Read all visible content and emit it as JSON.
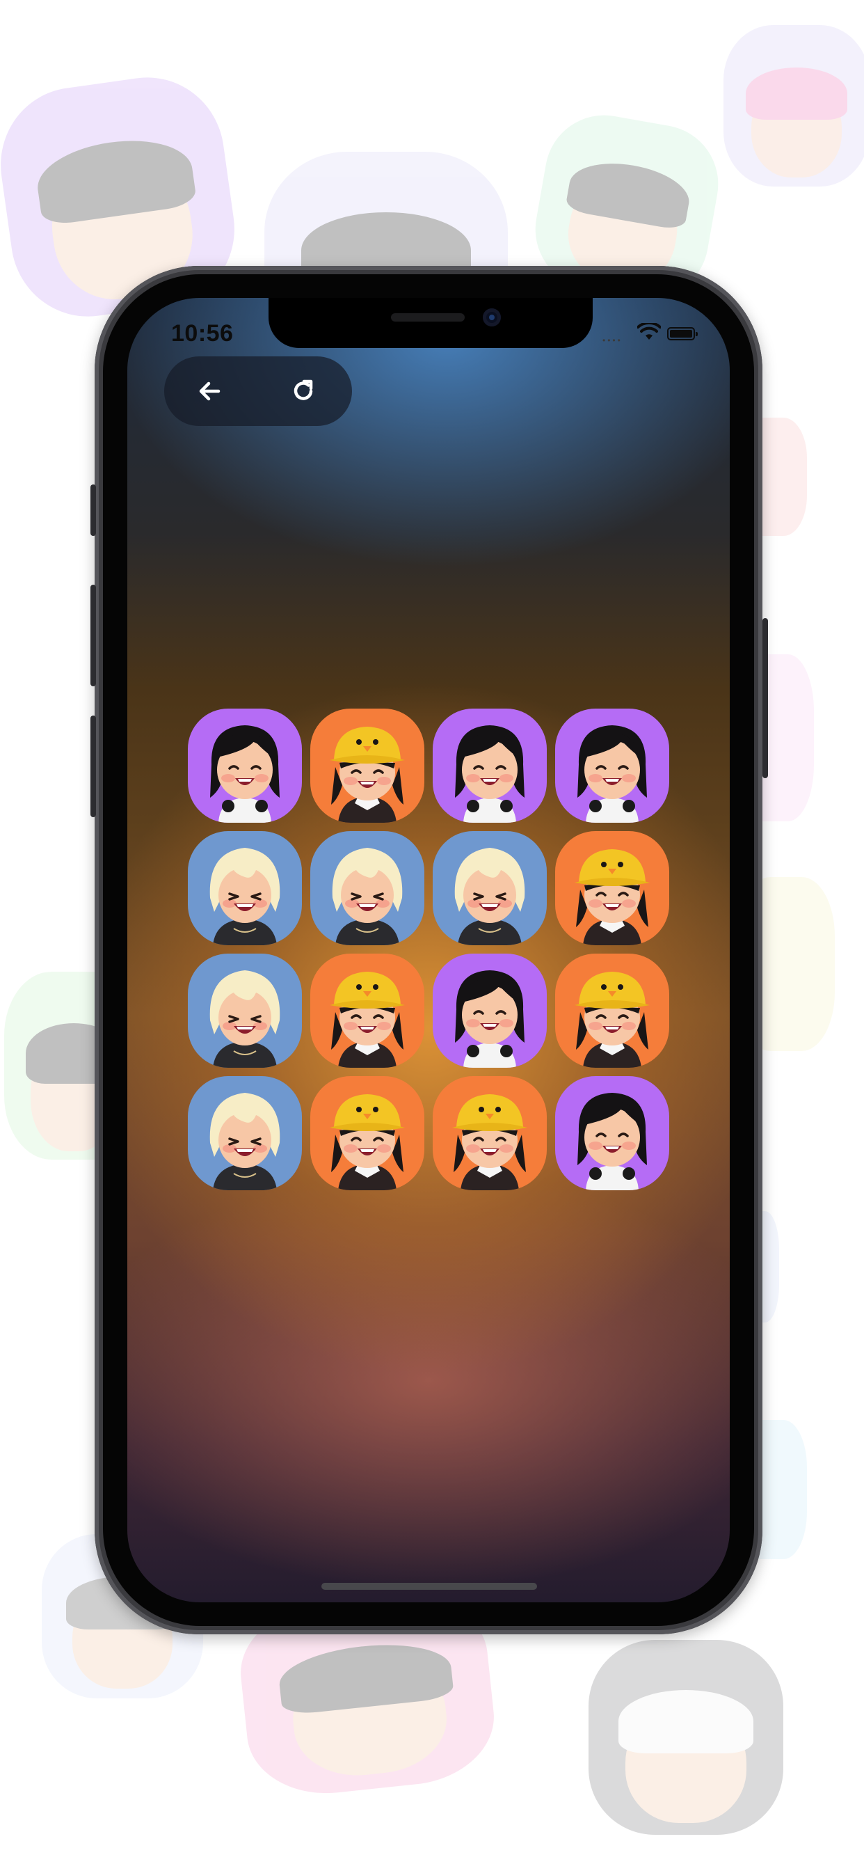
{
  "status_bar": {
    "time": "10:56",
    "signal_icon": "cellular-dots-icon",
    "wifi_icon": "wifi-icon",
    "battery_icon": "battery-icon"
  },
  "toolbar": {
    "back_icon": "arrow-left-icon",
    "reload_icon": "refresh-icon"
  },
  "board": {
    "rows": [
      [
        "purple-girl",
        "orange-duck-hat",
        "purple-girl",
        "purple-girl"
      ],
      [
        "blue-blond",
        "blue-blond",
        "blue-blond",
        "orange-duck-hat"
      ],
      [
        "blue-blond",
        "orange-duck-hat",
        "purple-girl",
        "orange-duck-hat"
      ],
      [
        "blue-blond",
        "orange-duck-hat",
        "orange-duck-hat",
        "purple-girl"
      ]
    ],
    "tile_colors": {
      "purple-girl": "#b56cf5",
      "orange-duck-hat": "#f57d3a",
      "blue-blond": "#6f98cf"
    }
  },
  "colors": {
    "toolbar_bg": "#161c28",
    "page_bg": "#ffffff"
  }
}
